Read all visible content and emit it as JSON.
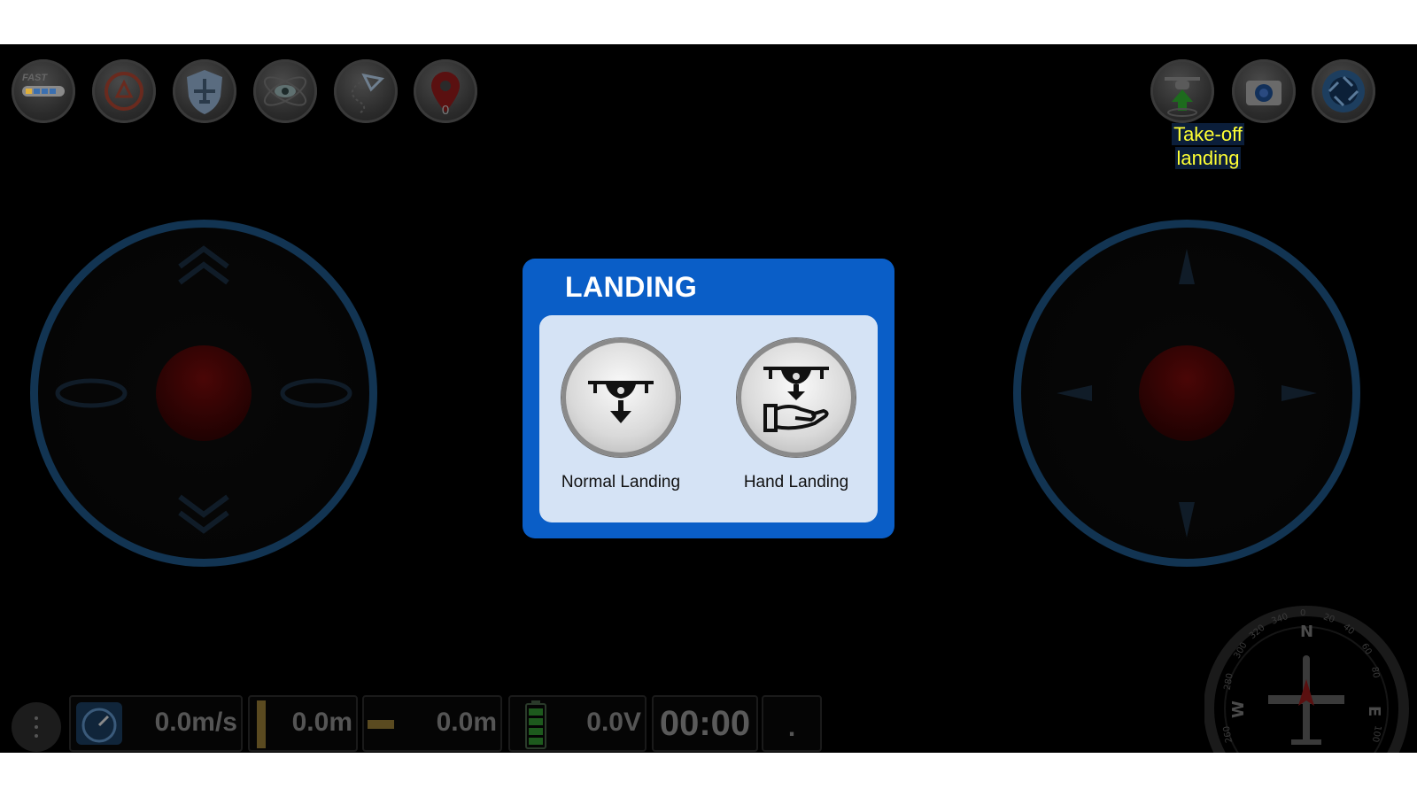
{
  "toolbar": {
    "left_icons": [
      "speed-mode-icon",
      "flip-icon",
      "shield-plane-icon",
      "atom-eye-icon",
      "waypoint-path-icon",
      "map-pin-icon"
    ],
    "pin_count": "0",
    "right_icons": [
      "takeoff-landing-icon",
      "camera-icon",
      "shutter-icon"
    ],
    "speed_mode_label": "FAST"
  },
  "tooltip": {
    "line1": "Take-off",
    "line2": "landing"
  },
  "dialog": {
    "title": "LANDING",
    "options": [
      {
        "label": "Normal Landing",
        "icon": "drone-down-arrow-icon"
      },
      {
        "label": "Hand Landing",
        "icon": "drone-hand-icon"
      }
    ]
  },
  "telemetry": {
    "speed": "0.0m/s",
    "altitude": "0.0m",
    "distance": "0.0m",
    "voltage": "0.0V",
    "timer": "00:00",
    "status": "."
  },
  "compass": {
    "n": "N",
    "e": "E",
    "w": "W",
    "ticks": [
      "0",
      "20",
      "40",
      "60",
      "80",
      "100",
      "260",
      "280",
      "300",
      "320",
      "340"
    ]
  },
  "colors": {
    "dialog_blue": "#0a5ec7",
    "dialog_inner": "#d5e3f5",
    "tooltip_text": "#ffff33",
    "ring": "#123452"
  }
}
